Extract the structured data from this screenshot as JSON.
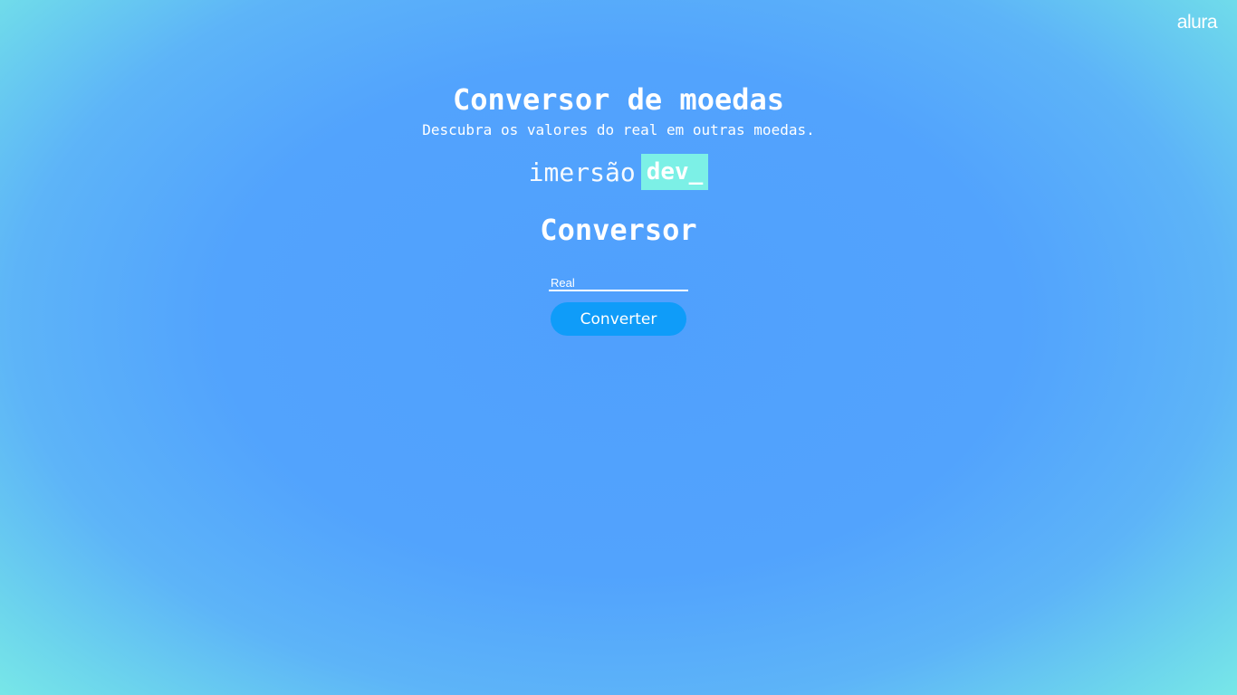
{
  "brand": {
    "logo_text": "alura"
  },
  "header": {
    "title": "Conversor de moedas",
    "subtitle": "Descubra os valores do real em outras moedas."
  },
  "event_logo": {
    "word": "imersão",
    "badge": "dev_",
    "badge_color": "#7cf0e6"
  },
  "converter": {
    "heading": "Conversor",
    "input": {
      "value": "",
      "placeholder": "Real"
    },
    "button_label": "Converter",
    "button_color": "#0f9cf9"
  }
}
